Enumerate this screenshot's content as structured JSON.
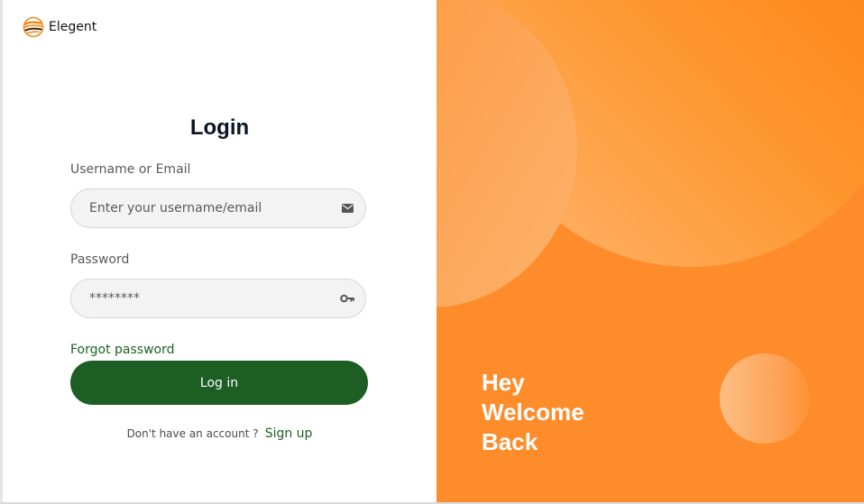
{
  "brand": {
    "name": "Elegent",
    "logo_icon": "stacked-waves-logo-icon"
  },
  "login": {
    "title": "Login",
    "username_label": "Username or Email",
    "username_placeholder": "Enter your username/email",
    "username_value": "",
    "username_icon": "envelope-icon",
    "password_label": "Password",
    "password_placeholder": "********",
    "password_value": "",
    "password_icon": "key-icon",
    "forgot_label": "Forgot password",
    "submit_label": "Log in",
    "signup_prompt": "Don't have an account ?",
    "signup_label": "Sign up"
  },
  "hero": {
    "line1": "Hey",
    "line2": "Welcome",
    "line3": "Back"
  },
  "colors": {
    "accent_green": "#1c5e23",
    "panel_orange": "#ff8c2b"
  }
}
